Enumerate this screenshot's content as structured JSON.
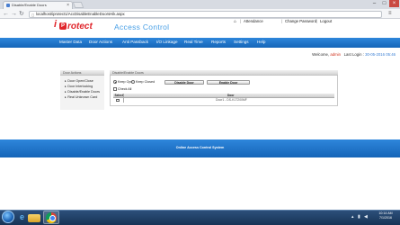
{
  "browser": {
    "tab_title": "Disable/Enable Doors",
    "tab_close": "×",
    "url": "localhost/iprotect1/AccDisableEnableDoorsHik.aspx",
    "icons": [
      "back-icon",
      "forward-icon",
      "reload-icon",
      "lock-icon",
      "menu-icon"
    ]
  },
  "header": {
    "logo_i": "i",
    "logo_badge": "P",
    "logo_text": "rotect",
    "product_name": "Access Control",
    "links": [
      "Attendance",
      "Change Password",
      "Logout"
    ]
  },
  "menu": {
    "items": [
      "Master Data",
      "Door Actions",
      "Anti Passback",
      "I/O Linkage",
      "Real Time",
      "Reports",
      "Settings",
      "Help"
    ]
  },
  "welcome": {
    "prefix": "Welcome,",
    "user": "admin",
    "last_login_label": "Last Login :",
    "last_login_value": "30-05-2016 05:46"
  },
  "sidebar": {
    "title": "Door Actions",
    "items": [
      "Door Open/Close",
      "Door Interlocking",
      "Disable/Enable Doors",
      "Real Unknown Card"
    ]
  },
  "panel": {
    "title": "Disable/Enable Doors",
    "option_keep_open": "Keep Open",
    "option_keep_closed": "Keep Closed",
    "disable_button": "Disable Door",
    "enable_button": "Enable Door",
    "check_all": "Check All",
    "grid_headers": [
      "Select",
      "Door"
    ],
    "grid_rows": [
      {
        "door": "Door1 - DS-K1T200MF"
      }
    ]
  },
  "footer": {
    "text": "Online Access Control System"
  },
  "taskbar": {
    "time": "10:14 AM",
    "date": "7/1/2016"
  }
}
